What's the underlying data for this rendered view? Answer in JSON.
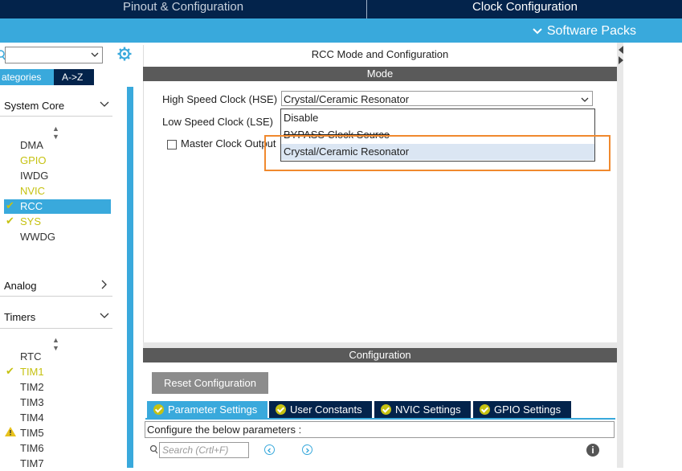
{
  "top_tabs": {
    "pinout": "Pinout & Configuration",
    "clock": "Clock Configuration"
  },
  "software_packs": "Software Packs",
  "left": {
    "category_tab": "ategories",
    "az_tab": "A->Z",
    "groups": {
      "system_core": "System Core",
      "analog": "Analog",
      "timers": "Timers"
    },
    "system_core_items": [
      "DMA",
      "GPIO",
      "IWDG",
      "NVIC",
      "RCC",
      "SYS",
      "WWDG"
    ],
    "timer_items": [
      "RTC",
      "TIM1",
      "TIM2",
      "TIM3",
      "TIM4",
      "TIM5",
      "TIM6",
      "TIM7"
    ]
  },
  "main": {
    "title": "RCC Mode and Configuration",
    "mode_header": "Mode",
    "hse_label": "High Speed Clock (HSE)",
    "hse_value": "Crystal/Ceramic Resonator",
    "lse_label": "Low Speed Clock (LSE)",
    "mco_label": "Master Clock Output",
    "options": [
      "Disable",
      "BYPASS Clock Source",
      "Crystal/Ceramic Resonator"
    ]
  },
  "config": {
    "header": "Configuration",
    "reset_button": "Reset Configuration",
    "tabs": [
      "Parameter Settings",
      "User Constants",
      "NVIC Settings",
      "GPIO Settings"
    ],
    "instructions": "Configure the below parameters :",
    "search_placeholder": "Search (Crtl+F)"
  },
  "colors": {
    "navy": "#03234b",
    "accent": "#39a9dc",
    "check": "#c6c212",
    "highlight": "#f0892e"
  }
}
